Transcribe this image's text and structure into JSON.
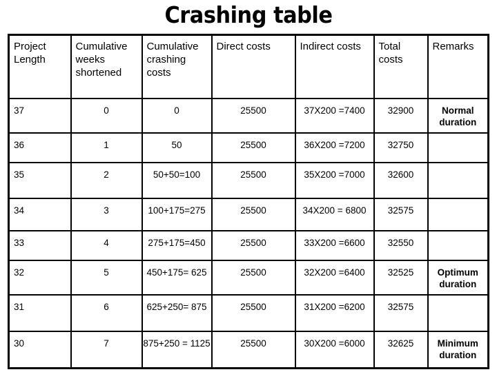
{
  "title": "Crashing table",
  "table": {
    "headers": [
      "Project Length",
      "Cumulative weeks shortened",
      "Cumulative crashing costs",
      "Direct costs",
      "Indirect costs",
      "Total costs",
      "Remarks"
    ],
    "rows": [
      {
        "project_length": "37",
        "weeks_shortened": "0",
        "crashing_costs": "0",
        "direct_costs": "25500",
        "indirect_costs": "37X200 =7400",
        "total_costs": "32900",
        "remarks": "Normal duration"
      },
      {
        "project_length": "36",
        "weeks_shortened": "1",
        "crashing_costs": "50",
        "direct_costs": "25500",
        "indirect_costs": "36X200 =7200",
        "total_costs": "32750",
        "remarks": ""
      },
      {
        "project_length": "35",
        "weeks_shortened": "2",
        "crashing_costs": "50+50=100",
        "direct_costs": "25500",
        "indirect_costs": "35X200 =7000",
        "total_costs": "32600",
        "remarks": ""
      },
      {
        "project_length": "34",
        "weeks_shortened": "3",
        "crashing_costs": "100+175=275",
        "direct_costs": "25500",
        "indirect_costs": "34X200 = 6800",
        "total_costs": "32575",
        "remarks": ""
      },
      {
        "project_length": "33",
        "weeks_shortened": "4",
        "crashing_costs": "275+175=450",
        "direct_costs": "25500",
        "indirect_costs": "33X200 =6600",
        "total_costs": "32550",
        "remarks": ""
      },
      {
        "project_length": "32",
        "weeks_shortened": "5",
        "crashing_costs": "450+175= 625",
        "direct_costs": "25500",
        "indirect_costs": "32X200 =6400",
        "total_costs": "32525",
        "remarks": "Optimum duration"
      },
      {
        "project_length": "31",
        "weeks_shortened": "6",
        "crashing_costs": "625+250= 875",
        "direct_costs": "25500",
        "indirect_costs": "31X200 =6200",
        "total_costs": "32575",
        "remarks": ""
      },
      {
        "project_length": "30",
        "weeks_shortened": "7",
        "crashing_costs": "875+250 = 1125",
        "direct_costs": "25500",
        "indirect_costs": "30X200 =6000",
        "total_costs": "32625",
        "remarks": "Minimum duration"
      }
    ]
  }
}
